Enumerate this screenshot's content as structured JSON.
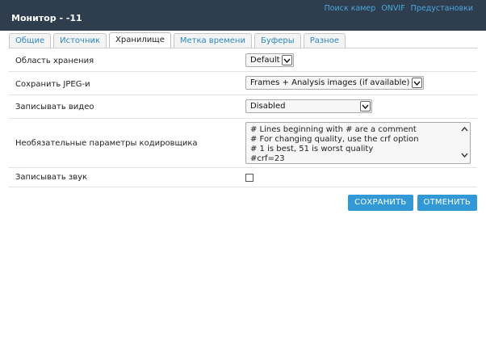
{
  "header": {
    "title": "Монитор - -11",
    "links": [
      "Поиск камер",
      "ONVIF",
      "Предустановки"
    ]
  },
  "tabs": [
    {
      "label": "Общие",
      "active": false
    },
    {
      "label": "Источник",
      "active": false
    },
    {
      "label": "Хранилище",
      "active": true
    },
    {
      "label": "Метка времени",
      "active": false
    },
    {
      "label": "Буферы",
      "active": false
    },
    {
      "label": "Разное",
      "active": false
    }
  ],
  "form": {
    "storage_area": {
      "label": "Область хранения",
      "value": "Default"
    },
    "save_jpeg": {
      "label": "Сохранить JPEG-и",
      "value": "Frames + Analysis images (if available)"
    },
    "record_video": {
      "label": "Записывать видео",
      "value": "Disabled"
    },
    "encoder_params": {
      "label": "Необязательные параметры кодировщика",
      "lines": [
        "# Lines beginning with # are a comment",
        "# For changing quality, use the crf option",
        "# 1 is best, 51 is worst quality",
        "#crf=23"
      ]
    },
    "record_audio": {
      "label": "Записывать звук",
      "checked": false
    }
  },
  "actions": {
    "save_label": "СОХРАНИТЬ",
    "cancel_label": "ОТМЕНИТЬ"
  },
  "colors": {
    "header_bg": "#2f3e4f",
    "link": "#4aa8de",
    "button": "#3399d6"
  }
}
